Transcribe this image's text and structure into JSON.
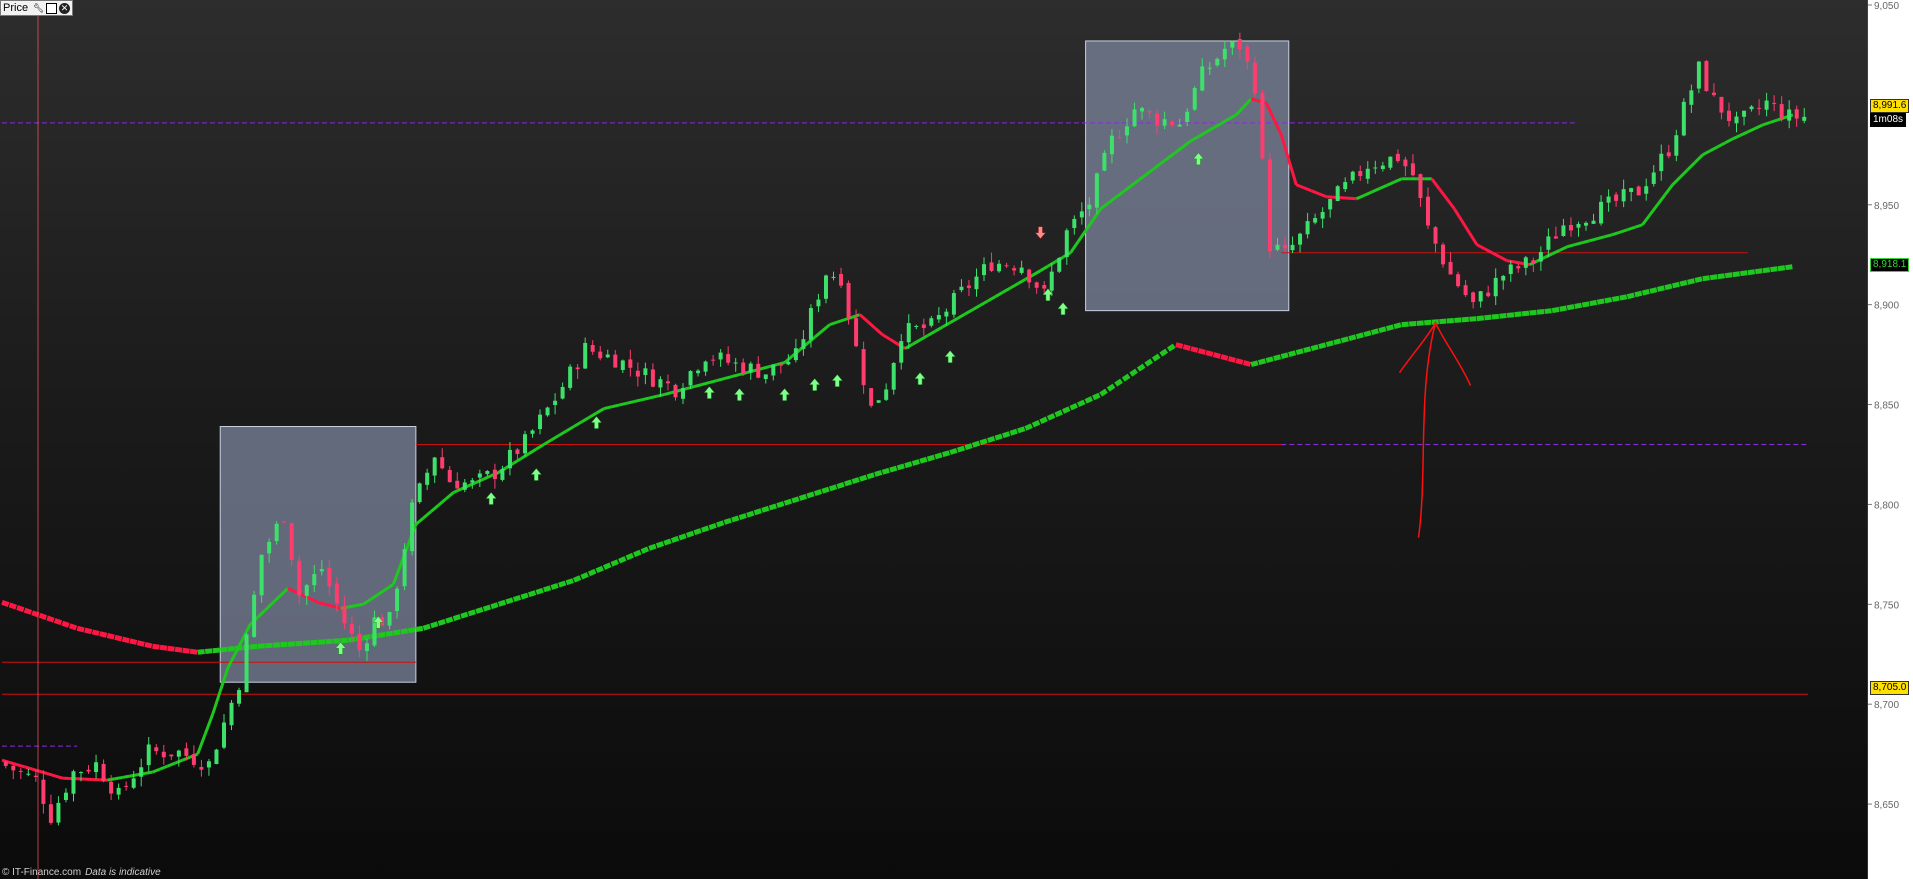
{
  "toolbar": {
    "title": "Price",
    "icons": [
      "wrench-icon",
      "window-icon",
      "close-icon"
    ]
  },
  "footer": {
    "copyright": "© IT-Finance.com",
    "notice": "Data is indicative"
  },
  "price_tags": {
    "last": "8,991.6",
    "timer": "1m08s",
    "ma": "8,918.1",
    "level": "8,705.0"
  },
  "colors": {
    "up": "#3de06a",
    "down": "#ff3c6e",
    "ma_up": "#1ec81e",
    "ma_down": "#ff1744",
    "level_line": "#cc1010",
    "dashed_purple": "#8a2be2",
    "annotation": "#ff1010",
    "range_box": "#7c869c",
    "tag_yellow": "#ffe000",
    "tag_green": "#39d439"
  },
  "chart_data": {
    "type": "candlestick",
    "title": "",
    "xlabel": "",
    "ylabel": "",
    "ylim": [
      8615,
      9050
    ],
    "y_ticks": [
      "9,050",
      "8,950",
      "8,900",
      "8,850",
      "8,800",
      "8,750",
      "8,700",
      "8,650"
    ],
    "x_range": [
      0,
      240
    ],
    "close_path": [
      [
        0,
        8671
      ],
      [
        5,
        8662
      ],
      [
        7,
        8644
      ],
      [
        10,
        8666
      ],
      [
        13,
        8670
      ],
      [
        16,
        8654
      ],
      [
        20,
        8676
      ],
      [
        24,
        8676
      ],
      [
        28,
        8670
      ],
      [
        32,
        8711
      ],
      [
        35,
        8775
      ],
      [
        38,
        8795
      ],
      [
        40,
        8755
      ],
      [
        43,
        8768
      ],
      [
        46,
        8741
      ],
      [
        48,
        8727
      ],
      [
        50,
        8742
      ],
      [
        52,
        8742
      ],
      [
        55,
        8798
      ],
      [
        58,
        8825
      ],
      [
        60,
        8812
      ],
      [
        63,
        8810
      ],
      [
        66,
        8816
      ],
      [
        70,
        8831
      ],
      [
        74,
        8853
      ],
      [
        78,
        8878
      ],
      [
        82,
        8873
      ],
      [
        86,
        8865
      ],
      [
        90,
        8858
      ],
      [
        94,
        8875
      ],
      [
        98,
        8870
      ],
      [
        102,
        8866
      ],
      [
        106,
        8874
      ],
      [
        110,
        8916
      ],
      [
        112,
        8914
      ],
      [
        114,
        8878
      ],
      [
        116,
        8848
      ],
      [
        118,
        8860
      ],
      [
        120,
        8886
      ],
      [
        124,
        8889
      ],
      [
        128,
        8906
      ],
      [
        132,
        8921
      ],
      [
        136,
        8920
      ],
      [
        139,
        8905
      ],
      [
        142,
        8936
      ],
      [
        145,
        8951
      ],
      [
        148,
        8982
      ],
      [
        151,
        8998
      ],
      [
        154,
        8993
      ],
      [
        157,
        8991
      ],
      [
        160,
        9015
      ],
      [
        163,
        9028
      ],
      [
        165,
        9030
      ],
      [
        167,
        9010
      ],
      [
        169,
        8930
      ],
      [
        171,
        8925
      ],
      [
        174,
        8938
      ],
      [
        178,
        8955
      ],
      [
        182,
        8970
      ],
      [
        186,
        8974
      ],
      [
        188,
        8965
      ],
      [
        190,
        8938
      ],
      [
        193,
        8915
      ],
      [
        196,
        8900
      ],
      [
        200,
        8915
      ],
      [
        204,
        8922
      ],
      [
        208,
        8940
      ],
      [
        213,
        8948
      ],
      [
        218,
        8957
      ],
      [
        222,
        8978
      ],
      [
        226,
        9018
      ],
      [
        228,
        9002
      ],
      [
        231,
        8990
      ],
      [
        235,
        9001
      ],
      [
        238,
        8994
      ]
    ],
    "series": [
      {
        "name": "",
        "style": "solid",
        "color_rule": "green when rising, red when falling",
        "points": [
          [
            0,
            8672
          ],
          [
            8,
            8663
          ],
          [
            14,
            8662
          ],
          [
            20,
            8666
          ],
          [
            26,
            8675
          ],
          [
            28,
            8695
          ],
          [
            30,
            8718
          ],
          [
            33,
            8740
          ],
          [
            38,
            8758
          ],
          [
            42,
            8751
          ],
          [
            45,
            8748
          ],
          [
            48,
            8750
          ],
          [
            52,
            8760
          ],
          [
            55,
            8790
          ],
          [
            60,
            8806
          ],
          [
            66,
            8816
          ],
          [
            72,
            8830
          ],
          [
            80,
            8848
          ],
          [
            88,
            8855
          ],
          [
            96,
            8863
          ],
          [
            104,
            8871
          ],
          [
            110,
            8890
          ],
          [
            114,
            8895
          ],
          [
            117,
            8885
          ],
          [
            120,
            8878
          ],
          [
            126,
            8891
          ],
          [
            132,
            8904
          ],
          [
            138,
            8917
          ],
          [
            142,
            8926
          ],
          [
            146,
            8948
          ],
          [
            152,
            8965
          ],
          [
            158,
            8982
          ],
          [
            164,
            8995
          ],
          [
            166,
            9003
          ],
          [
            168,
            9001
          ],
          [
            170,
            8985
          ],
          [
            172,
            8960
          ],
          [
            176,
            8954
          ],
          [
            180,
            8953
          ],
          [
            186,
            8963
          ],
          [
            190,
            8963
          ],
          [
            193,
            8948
          ],
          [
            196,
            8930
          ],
          [
            200,
            8922
          ],
          [
            203,
            8920
          ],
          [
            208,
            8929
          ],
          [
            214,
            8935
          ],
          [
            218,
            8940
          ],
          [
            222,
            8960
          ],
          [
            226,
            8975
          ],
          [
            230,
            8983
          ],
          [
            234,
            8990
          ],
          [
            238,
            8995
          ]
        ]
      },
      {
        "name": "",
        "style": "dashed",
        "color_rule": "green when rising, red when falling",
        "points": [
          [
            0,
            8751
          ],
          [
            10,
            8738
          ],
          [
            20,
            8729
          ],
          [
            26,
            8726
          ],
          [
            34,
            8729
          ],
          [
            46,
            8732
          ],
          [
            56,
            8738
          ],
          [
            66,
            8750
          ],
          [
            76,
            8762
          ],
          [
            86,
            8778
          ],
          [
            96,
            8791
          ],
          [
            106,
            8803
          ],
          [
            116,
            8815
          ],
          [
            126,
            8826
          ],
          [
            136,
            8838
          ],
          [
            146,
            8855
          ],
          [
            156,
            8880
          ],
          [
            166,
            8870
          ],
          [
            176,
            8880
          ],
          [
            186,
            8890
          ],
          [
            196,
            8893
          ],
          [
            206,
            8897
          ],
          [
            216,
            8904
          ],
          [
            226,
            8913
          ],
          [
            238,
            8919
          ]
        ]
      }
    ],
    "horizontal_lines": [
      {
        "price": 8721,
        "style": "solid",
        "color": "red",
        "span": [
          0,
          55
        ]
      },
      {
        "price": 8705,
        "style": "solid",
        "color": "red",
        "span": [
          0,
          240
        ]
      },
      {
        "price": 8830,
        "style": "solid",
        "color": "red",
        "span": [
          55,
          170
        ]
      },
      {
        "price": 8926,
        "style": "solid",
        "color": "red",
        "span": [
          170,
          232
        ]
      },
      {
        "price": 8991,
        "style": "dashed",
        "color": "purple",
        "span": [
          0,
          209
        ]
      },
      {
        "price": 8830,
        "style": "dashed",
        "color": "purple",
        "span": [
          170,
          240
        ]
      },
      {
        "price": 8679,
        "style": "dashed",
        "color": "purple",
        "span": [
          0,
          10
        ]
      }
    ],
    "range_boxes": [
      {
        "x": [
          29,
          55
        ],
        "y": [
          8711,
          8839
        ]
      },
      {
        "x": [
          144,
          171
        ],
        "y": [
          8897,
          9032
        ]
      }
    ],
    "signal_arrows": {
      "buy": [
        [
          45,
          8731
        ],
        [
          50,
          8744
        ],
        [
          65,
          8806
        ],
        [
          71,
          8818
        ],
        [
          79,
          8844
        ],
        [
          94,
          8859
        ],
        [
          98,
          8858
        ],
        [
          104,
          8858
        ],
        [
          108,
          8863
        ],
        [
          111,
          8865
        ],
        [
          122,
          8866
        ],
        [
          126,
          8877
        ],
        [
          139,
          8908
        ],
        [
          141,
          8901
        ],
        [
          159,
          8976
        ]
      ],
      "sell": [
        [
          138,
          8933
        ]
      ]
    },
    "legend": "none",
    "grid": false
  }
}
